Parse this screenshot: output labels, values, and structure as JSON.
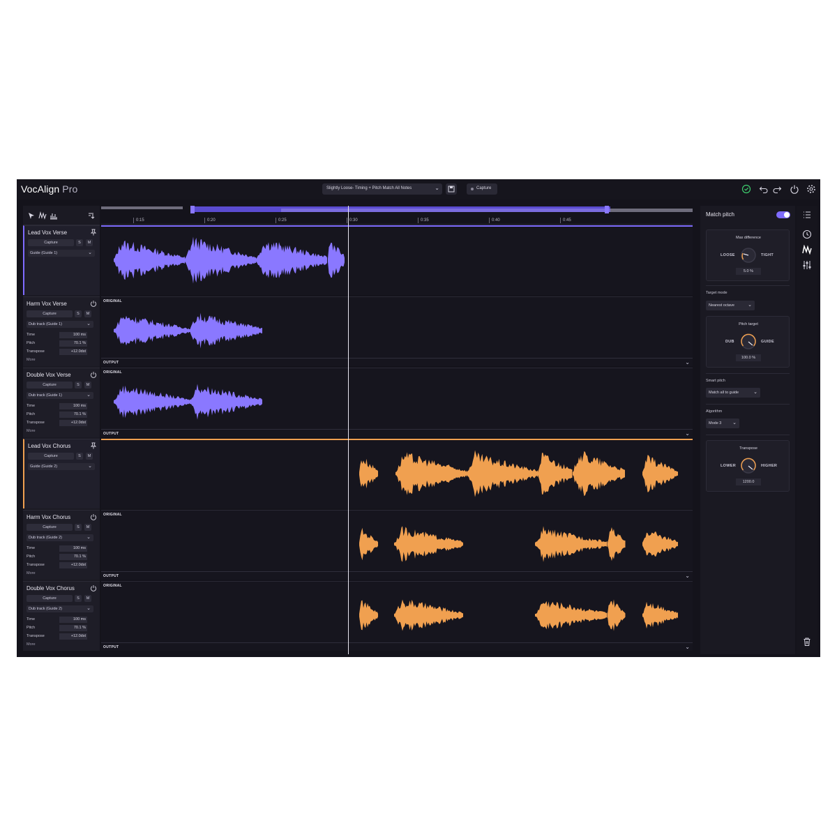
{
  "app": {
    "name": "VocAlign",
    "edition": "Pro"
  },
  "topbar": {
    "preset": "Slightly Loose- Timing + Pitch Match All Notes",
    "capture_label": "Capture"
  },
  "timeline": {
    "ticks": [
      "0:15",
      "0:20",
      "0:25",
      "0:30",
      "0:35",
      "0:40",
      "0:45"
    ]
  },
  "tracks": [
    {
      "name": "Lead Vox Verse",
      "capture": "Capture",
      "solo": "S",
      "mute": "M",
      "route": "Guide (Guide 1)",
      "icon": "pin-icon"
    },
    {
      "name": "Harm Vox Verse",
      "capture": "Capture",
      "solo": "S",
      "mute": "M",
      "route": "Dub track (Guide 1)",
      "icon": "power-icon",
      "params": [
        {
          "label": "Time",
          "value": "100 ms"
        },
        {
          "label": "Pitch",
          "value": "70.1 %"
        },
        {
          "label": "Transpose",
          "value": "+12.0dst"
        }
      ],
      "more": "More"
    },
    {
      "name": "Double Vox Verse",
      "capture": "Capture",
      "solo": "S",
      "mute": "M",
      "route": "Dub track (Guide 1)",
      "icon": "power-icon",
      "params": [
        {
          "label": "Time",
          "value": "100 ms"
        },
        {
          "label": "Pitch",
          "value": "70.1 %"
        },
        {
          "label": "Transpose",
          "value": "+12.0dst"
        }
      ],
      "more": "More"
    },
    {
      "name": "Lead Vox Chorus",
      "capture": "Capture",
      "solo": "S",
      "mute": "M",
      "route": "Guide (Guide 2)",
      "icon": "pin-icon"
    },
    {
      "name": "Harm Vox Chorus",
      "capture": "Capture",
      "solo": "S",
      "mute": "M",
      "route": "Dub track (Guide 2)",
      "icon": "power-icon",
      "params": [
        {
          "label": "Time",
          "value": "100 ms"
        },
        {
          "label": "Pitch",
          "value": "70.1 %"
        },
        {
          "label": "Transpose",
          "value": "+12.0dst"
        }
      ],
      "more": "More"
    },
    {
      "name": "Double Vox Chorus",
      "capture": "Capture",
      "solo": "S",
      "mute": "M",
      "route": "Dub track (Guide 2)",
      "icon": "power-icon",
      "params": [
        {
          "label": "Time",
          "value": "100 ms"
        },
        {
          "label": "Pitch",
          "value": "70.1 %"
        },
        {
          "label": "Transpose",
          "value": "+12.0dst"
        }
      ],
      "more": "More"
    }
  ],
  "lanes": {
    "original_label": "ORIGINAL",
    "output_label": "OUTPUT"
  },
  "right_panel": {
    "title": "Match pitch",
    "match_pitch_on": true,
    "max_difference": {
      "title": "Max difference",
      "left": "LOOSE",
      "right": "TIGHT",
      "value": "5.0 %"
    },
    "target_mode": {
      "label": "Target mode",
      "value": "Nearest octave"
    },
    "pitch_target": {
      "title": "Pitch target",
      "left": "DUB",
      "right": "GUIDE",
      "value": "100.0 %"
    },
    "smart_pitch": {
      "label": "Smart pitch",
      "value": "Match all to guide"
    },
    "algorithm": {
      "label": "Algorithm",
      "value": "Mode 3"
    },
    "transpose": {
      "title": "Transpose",
      "left": "LOWER",
      "right": "HIGHER",
      "value": "1200.0"
    }
  },
  "colors": {
    "guide1": "#8a78ff",
    "guide2": "#f0a050",
    "accent": "#7f6cff",
    "ok": "#3ecf6e"
  }
}
